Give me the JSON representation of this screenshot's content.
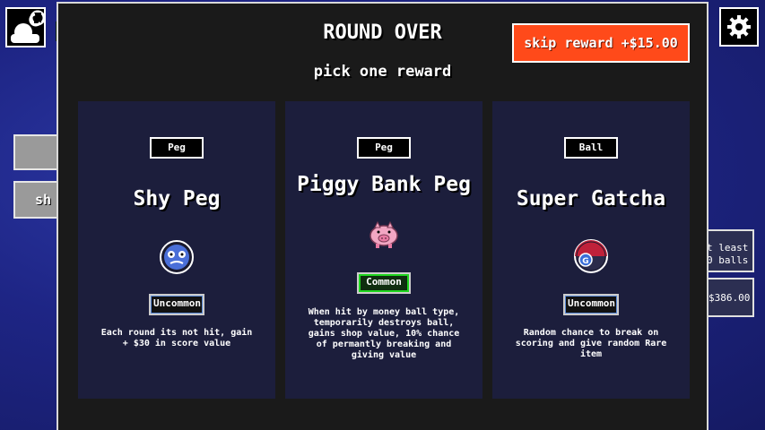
{
  "background": {
    "side_button_2_label": "sh",
    "info_box_text_1": "t least",
    "info_box_text_2": "0 balls",
    "info_box_money": "$386.00"
  },
  "modal": {
    "title": "ROUND OVER",
    "subtitle": "pick one reward",
    "skip_label": "skip reward +$15.00"
  },
  "cards": [
    {
      "type": "Peg",
      "name": "Shy Peg",
      "rarity": "Uncommon",
      "description": "Each round its not hit, gain + $30 in score value",
      "icon": "shy-peg-icon"
    },
    {
      "type": "Peg",
      "name": "Piggy Bank Peg",
      "rarity": "Common",
      "description": "When hit by money ball type, temporarily destroys ball, gains shop value, 10% chance of permantly breaking and giving value",
      "icon": "piggy-bank-icon"
    },
    {
      "type": "Ball",
      "name": "Super Gatcha",
      "rarity": "Uncommon",
      "description": "Random chance to break on scoring and give random Rare item",
      "icon": "gatcha-ball-icon"
    }
  ],
  "colors": {
    "skip_button": "#ff4a1a",
    "card_bg": "#1c1e3c",
    "uncommon_accent": "#5b8bd9",
    "common_accent": "#1ed61e"
  }
}
